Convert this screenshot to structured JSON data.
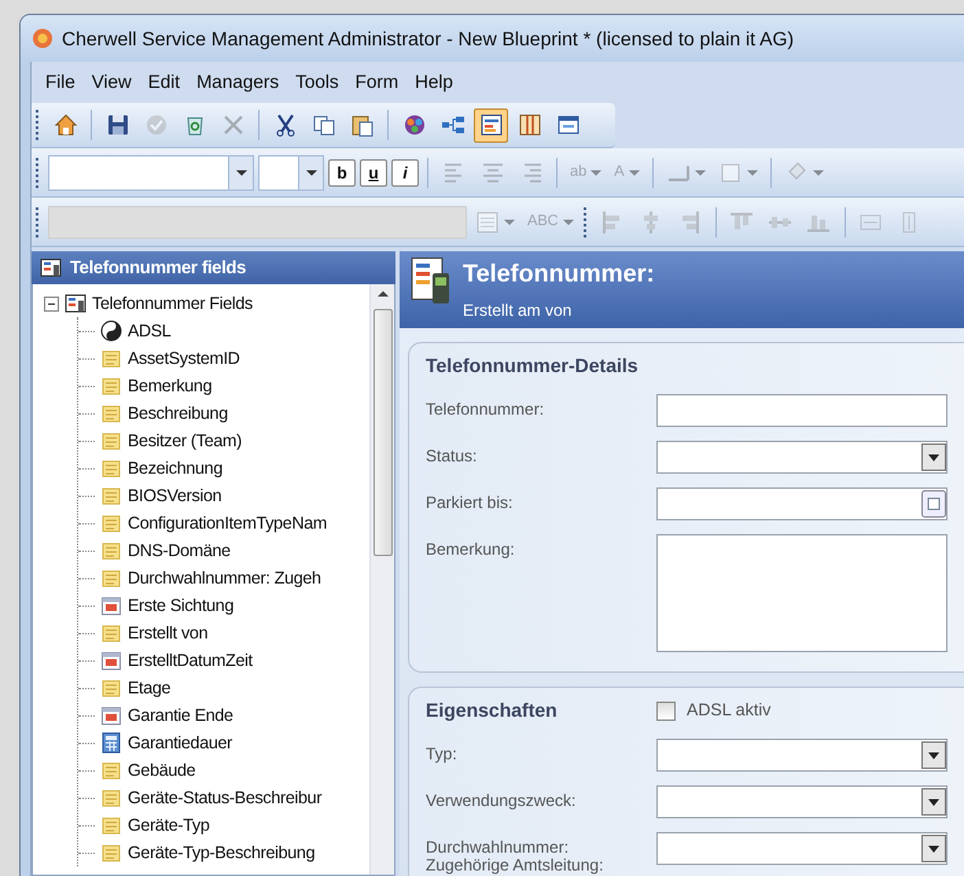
{
  "window": {
    "title": "Cherwell Service Management Administrator - New Blueprint * (licensed to plain it AG)"
  },
  "menu": [
    "File",
    "View",
    "Edit",
    "Managers",
    "Tools",
    "Form",
    "Help"
  ],
  "toolbar_main": [
    {
      "kind": "button",
      "disabled": false,
      "selected": false
    },
    {
      "kind": "separator"
    },
    {
      "kind": "button",
      "disabled": false,
      "selected": false
    },
    {
      "kind": "button",
      "disabled": true,
      "selected": false
    },
    {
      "kind": "button",
      "disabled": false,
      "selected": false
    },
    {
      "kind": "button",
      "disabled": true,
      "selected": false
    },
    {
      "kind": "separator"
    },
    {
      "kind": "button",
      "disabled": false,
      "selected": false
    },
    {
      "kind": "button",
      "disabled": false,
      "selected": false
    },
    {
      "kind": "button",
      "disabled": false,
      "selected": false
    },
    {
      "kind": "separator"
    },
    {
      "kind": "button",
      "disabled": false,
      "selected": false
    },
    {
      "kind": "button",
      "disabled": false,
      "selected": false
    },
    {
      "kind": "button",
      "disabled": false,
      "selected": true
    },
    {
      "kind": "button",
      "disabled": false,
      "selected": false
    },
    {
      "kind": "button",
      "disabled": false,
      "selected": false
    }
  ],
  "toolbar_format": [
    {
      "kind": "combo"
    },
    {
      "kind": "combo-small"
    },
    {
      "kind": "text-button",
      "label": "b",
      "disabled": false
    },
    {
      "kind": "text-button",
      "label": "u",
      "disabled": false
    },
    {
      "kind": "text-button",
      "label": "i",
      "disabled": false
    },
    {
      "kind": "separator"
    },
    {
      "kind": "icon-button",
      "disabled": true
    },
    {
      "kind": "icon-button",
      "disabled": true
    },
    {
      "kind": "icon-button",
      "disabled": true
    },
    {
      "kind": "separator"
    },
    {
      "kind": "text-dropdown",
      "label": "ab",
      "disabled": true
    },
    {
      "kind": "text-dropdown",
      "label": "A",
      "disabled": true
    },
    {
      "kind": "separator"
    },
    {
      "kind": "icon-dropdown",
      "disabled": true
    },
    {
      "kind": "icon-dropdown",
      "disabled": true
    },
    {
      "kind": "separator"
    },
    {
      "kind": "icon-dropdown",
      "disabled": true
    }
  ],
  "toolbar_layout": [
    {
      "kind": "field",
      "disabled": true
    },
    {
      "kind": "icon-dropdown",
      "disabled": true
    },
    {
      "kind": "text-dropdown",
      "label": "ABC",
      "disabled": true
    },
    {
      "kind": "grip"
    },
    {
      "kind": "icon-button",
      "disabled": true
    },
    {
      "kind": "icon-button",
      "disabled": true
    },
    {
      "kind": "icon-button",
      "disabled": true
    },
    {
      "kind": "separator"
    },
    {
      "kind": "icon-button",
      "disabled": true
    },
    {
      "kind": "icon-button",
      "disabled": true
    },
    {
      "kind": "icon-button",
      "disabled": true
    },
    {
      "kind": "separator"
    },
    {
      "kind": "icon-button",
      "disabled": true
    },
    {
      "kind": "icon-button",
      "disabled": true
    }
  ],
  "sidebar": {
    "title": "Telefonnummer fields",
    "tree": [
      {
        "label": "Telefonnummer Fields",
        "kind": "table",
        "expanded": true,
        "children": [
          {
            "label": "ADSL",
            "kind": "boolean"
          },
          {
            "label": "AssetSystemID",
            "kind": "text"
          },
          {
            "label": "Bemerkung",
            "kind": "text"
          },
          {
            "label": "Beschreibung",
            "kind": "text"
          },
          {
            "label": "Besitzer (Team)",
            "kind": "text"
          },
          {
            "label": "Bezeichnung",
            "kind": "text"
          },
          {
            "label": "BIOSVersion",
            "kind": "text"
          },
          {
            "label": "ConfigurationItemTypeNam",
            "kind": "text"
          },
          {
            "label": "DNS-Domäne",
            "kind": "text"
          },
          {
            "label": "Durchwahlnummer: Zugeh",
            "kind": "text"
          },
          {
            "label": "Erste Sichtung",
            "kind": "date"
          },
          {
            "label": "Erstellt von",
            "kind": "text"
          },
          {
            "label": "ErstelltDatumZeit",
            "kind": "date"
          },
          {
            "label": "Etage",
            "kind": "text"
          },
          {
            "label": "Garantie Ende",
            "kind": "date"
          },
          {
            "label": "Garantiedauer",
            "kind": "number"
          },
          {
            "label": "Gebäude",
            "kind": "text"
          },
          {
            "label": "Geräte-Status-Beschreibur",
            "kind": "text"
          },
          {
            "label": "Geräte-Typ",
            "kind": "text"
          },
          {
            "label": "Geräte-Typ-Beschreibung",
            "kind": "text"
          }
        ]
      }
    ]
  },
  "form": {
    "title": "Telefonnummer:",
    "subtitle": "Erstellt am  von",
    "groups": [
      {
        "title": "Telefonnummer-Details",
        "fields": [
          {
            "label": "Telefonnummer:",
            "kind": "text"
          },
          {
            "label": "Status:",
            "kind": "dropdown"
          },
          {
            "label": "Parkiert bis:",
            "kind": "date"
          },
          {
            "label": "Bemerkung:",
            "kind": "textarea"
          }
        ]
      },
      {
        "title": "Eigenschaften",
        "checkbox": {
          "label": "ADSL aktiv",
          "checked": false
        },
        "fields": [
          {
            "label": "Typ:",
            "kind": "dropdown"
          },
          {
            "label": "Verwendungszweck:",
            "kind": "dropdown"
          },
          {
            "label": "Durchwahlnummer: Zugehörige Amtsleitung:",
            "kind": "dropdown"
          }
        ]
      }
    ]
  }
}
